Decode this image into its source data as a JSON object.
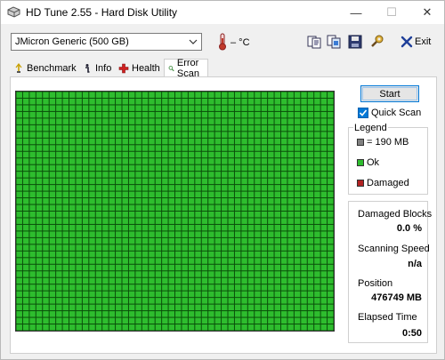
{
  "window": {
    "title": "HD Tune 2.55 - Hard Disk Utility",
    "minimize_glyph": "—",
    "maximize_glyph": "☐",
    "close_glyph": "✕"
  },
  "toolbar": {
    "drive": "JMicron Generic (500 GB)",
    "temperature": "– °C",
    "exit_label": "Exit",
    "icons": [
      "copy-text-icon",
      "copy-screenshot-icon",
      "save-icon",
      "options-icon"
    ]
  },
  "tabs": [
    {
      "label": "Benchmark",
      "icon": "benchmark-icon",
      "active": false
    },
    {
      "label": "Info",
      "icon": "info-icon",
      "active": false
    },
    {
      "label": "Health",
      "icon": "health-icon",
      "active": false
    },
    {
      "label": "Error Scan",
      "icon": "search-icon",
      "active": true
    }
  ],
  "scan": {
    "start_label": "Start",
    "quick_scan_label": "Quick Scan",
    "quick_scan_checked": true,
    "ok_color": "#2ebd2e",
    "damaged_color": "#b22222",
    "block_color": "#808080"
  },
  "legend": {
    "title": "Legend",
    "block_size": "= 190 MB",
    "ok": "Ok",
    "damaged": "Damaged"
  },
  "stats": {
    "damaged_blocks_label": "Damaged Blocks",
    "damaged_blocks_value": "0.0 %",
    "scanning_speed_label": "Scanning Speed",
    "scanning_speed_value": "n/a",
    "position_label": "Position",
    "position_value": "476749 MB",
    "elapsed_label": "Elapsed Time",
    "elapsed_value": "0:50"
  }
}
